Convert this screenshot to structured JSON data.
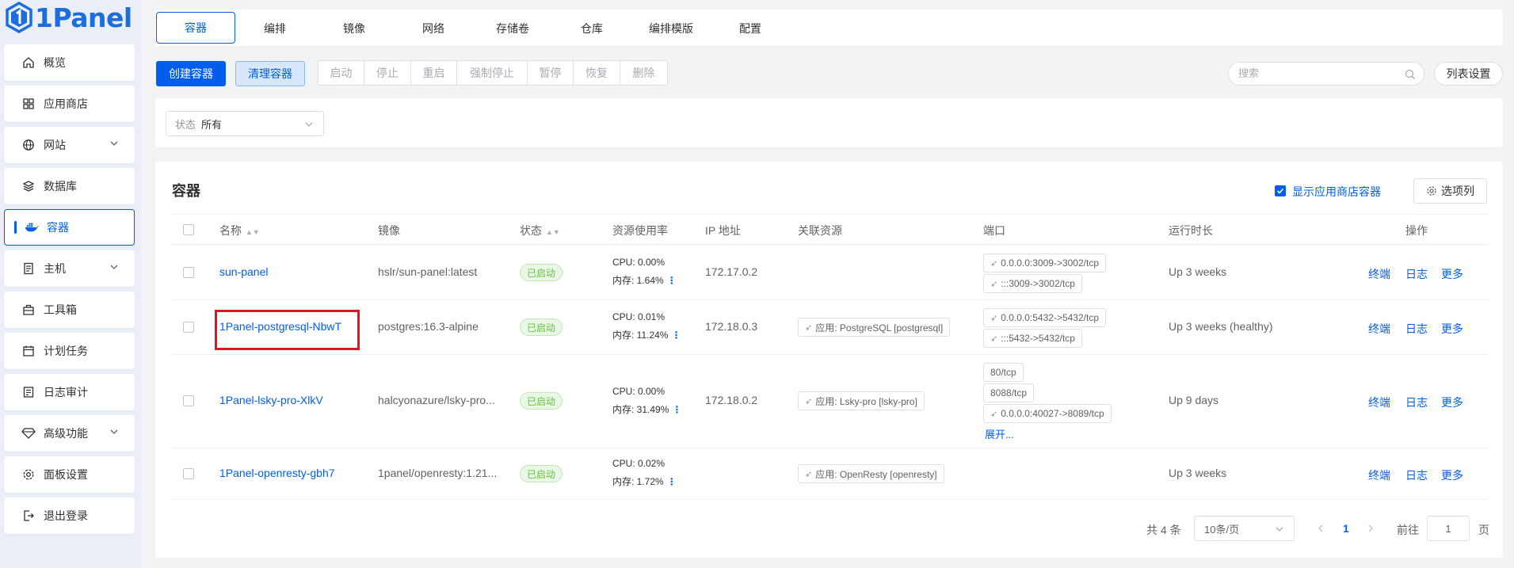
{
  "app": {
    "logo_text": "1Panel"
  },
  "sidebar": {
    "items": [
      {
        "label": "概览"
      },
      {
        "label": "应用商店"
      },
      {
        "label": "网站"
      },
      {
        "label": "数据库"
      },
      {
        "label": "容器"
      },
      {
        "label": "主机"
      },
      {
        "label": "工具箱"
      },
      {
        "label": "计划任务"
      },
      {
        "label": "日志审计"
      },
      {
        "label": "高级功能"
      },
      {
        "label": "面板设置"
      },
      {
        "label": "退出登录"
      }
    ]
  },
  "tabs": [
    {
      "label": "容器"
    },
    {
      "label": "编排"
    },
    {
      "label": "镜像"
    },
    {
      "label": "网络"
    },
    {
      "label": "存储卷"
    },
    {
      "label": "仓库"
    },
    {
      "label": "编排模版"
    },
    {
      "label": "配置"
    }
  ],
  "toolbar": {
    "create": "创建容器",
    "clean": "清理容器",
    "actions": [
      "启动",
      "停止",
      "重启",
      "强制停止",
      "暂停",
      "恢复",
      "删除"
    ],
    "search_placeholder": "搜索",
    "list_settings": "列表设置"
  },
  "filter": {
    "status_label": "状态",
    "status_value": "所有"
  },
  "table_card": {
    "title": "容器",
    "show_app_store_label": "显示应用商店容器",
    "columns_button": "选项列",
    "headers": {
      "name": "名称",
      "image": "镜像",
      "status": "状态",
      "resource": "资源使用率",
      "ip": "IP 地址",
      "related": "关联资源",
      "ports": "端口",
      "uptime": "运行时长",
      "ops": "操作"
    },
    "rows": [
      {
        "name": "sun-panel",
        "image": "hslr/sun-panel:latest",
        "status": "已启动",
        "cpu": "CPU: 0.00%",
        "mem": "内存: 1.64%",
        "ip": "172.17.0.2",
        "related": "",
        "ports": [
          "0.0.0.0:3009->3002/tcp",
          ":::3009->3002/tcp"
        ],
        "uptime": "Up 3 weeks"
      },
      {
        "name": "1Panel-postgresql-NbwT",
        "image": "postgres:16.3-alpine",
        "status": "已启动",
        "cpu": "CPU: 0.01%",
        "mem": "内存: 11.24%",
        "ip": "172.18.0.3",
        "related": "应用: PostgreSQL [postgresql]",
        "ports": [
          "0.0.0.0:5432->5432/tcp",
          ":::5432->5432/tcp"
        ],
        "uptime": "Up 3 weeks (healthy)"
      },
      {
        "name": "1Panel-lsky-pro-XlkV",
        "image": "halcyonazure/lsky-pro...",
        "status": "已启动",
        "cpu": "CPU: 0.00%",
        "mem": "内存: 31.49%",
        "ip": "172.18.0.2",
        "related": "应用: Lsky-pro [lsky-pro]",
        "ports": [
          "80/tcp",
          "8088/tcp",
          "0.0.0.0:40027->8089/tcp"
        ],
        "expand": "展开...",
        "uptime": "Up 9 days"
      },
      {
        "name": "1Panel-openresty-gbh7",
        "image": "1panel/openresty:1.21...",
        "status": "已启动",
        "cpu": "CPU: 0.02%",
        "mem": "内存: 1.72%",
        "ip": "",
        "related": "应用: OpenResty [openresty]",
        "ports": [],
        "uptime": "Up 3 weeks"
      }
    ],
    "ops": {
      "terminal": "终端",
      "log": "日志",
      "more": "更多"
    }
  },
  "pagination": {
    "total": "共 4 条",
    "page_size": "10条/页",
    "current": "1",
    "goto_label": "前往",
    "goto_value": "1",
    "page_suffix": "页"
  },
  "colors": {
    "primary": "#005eeb",
    "success": "#67c23a",
    "highlight": "#e0141e"
  }
}
